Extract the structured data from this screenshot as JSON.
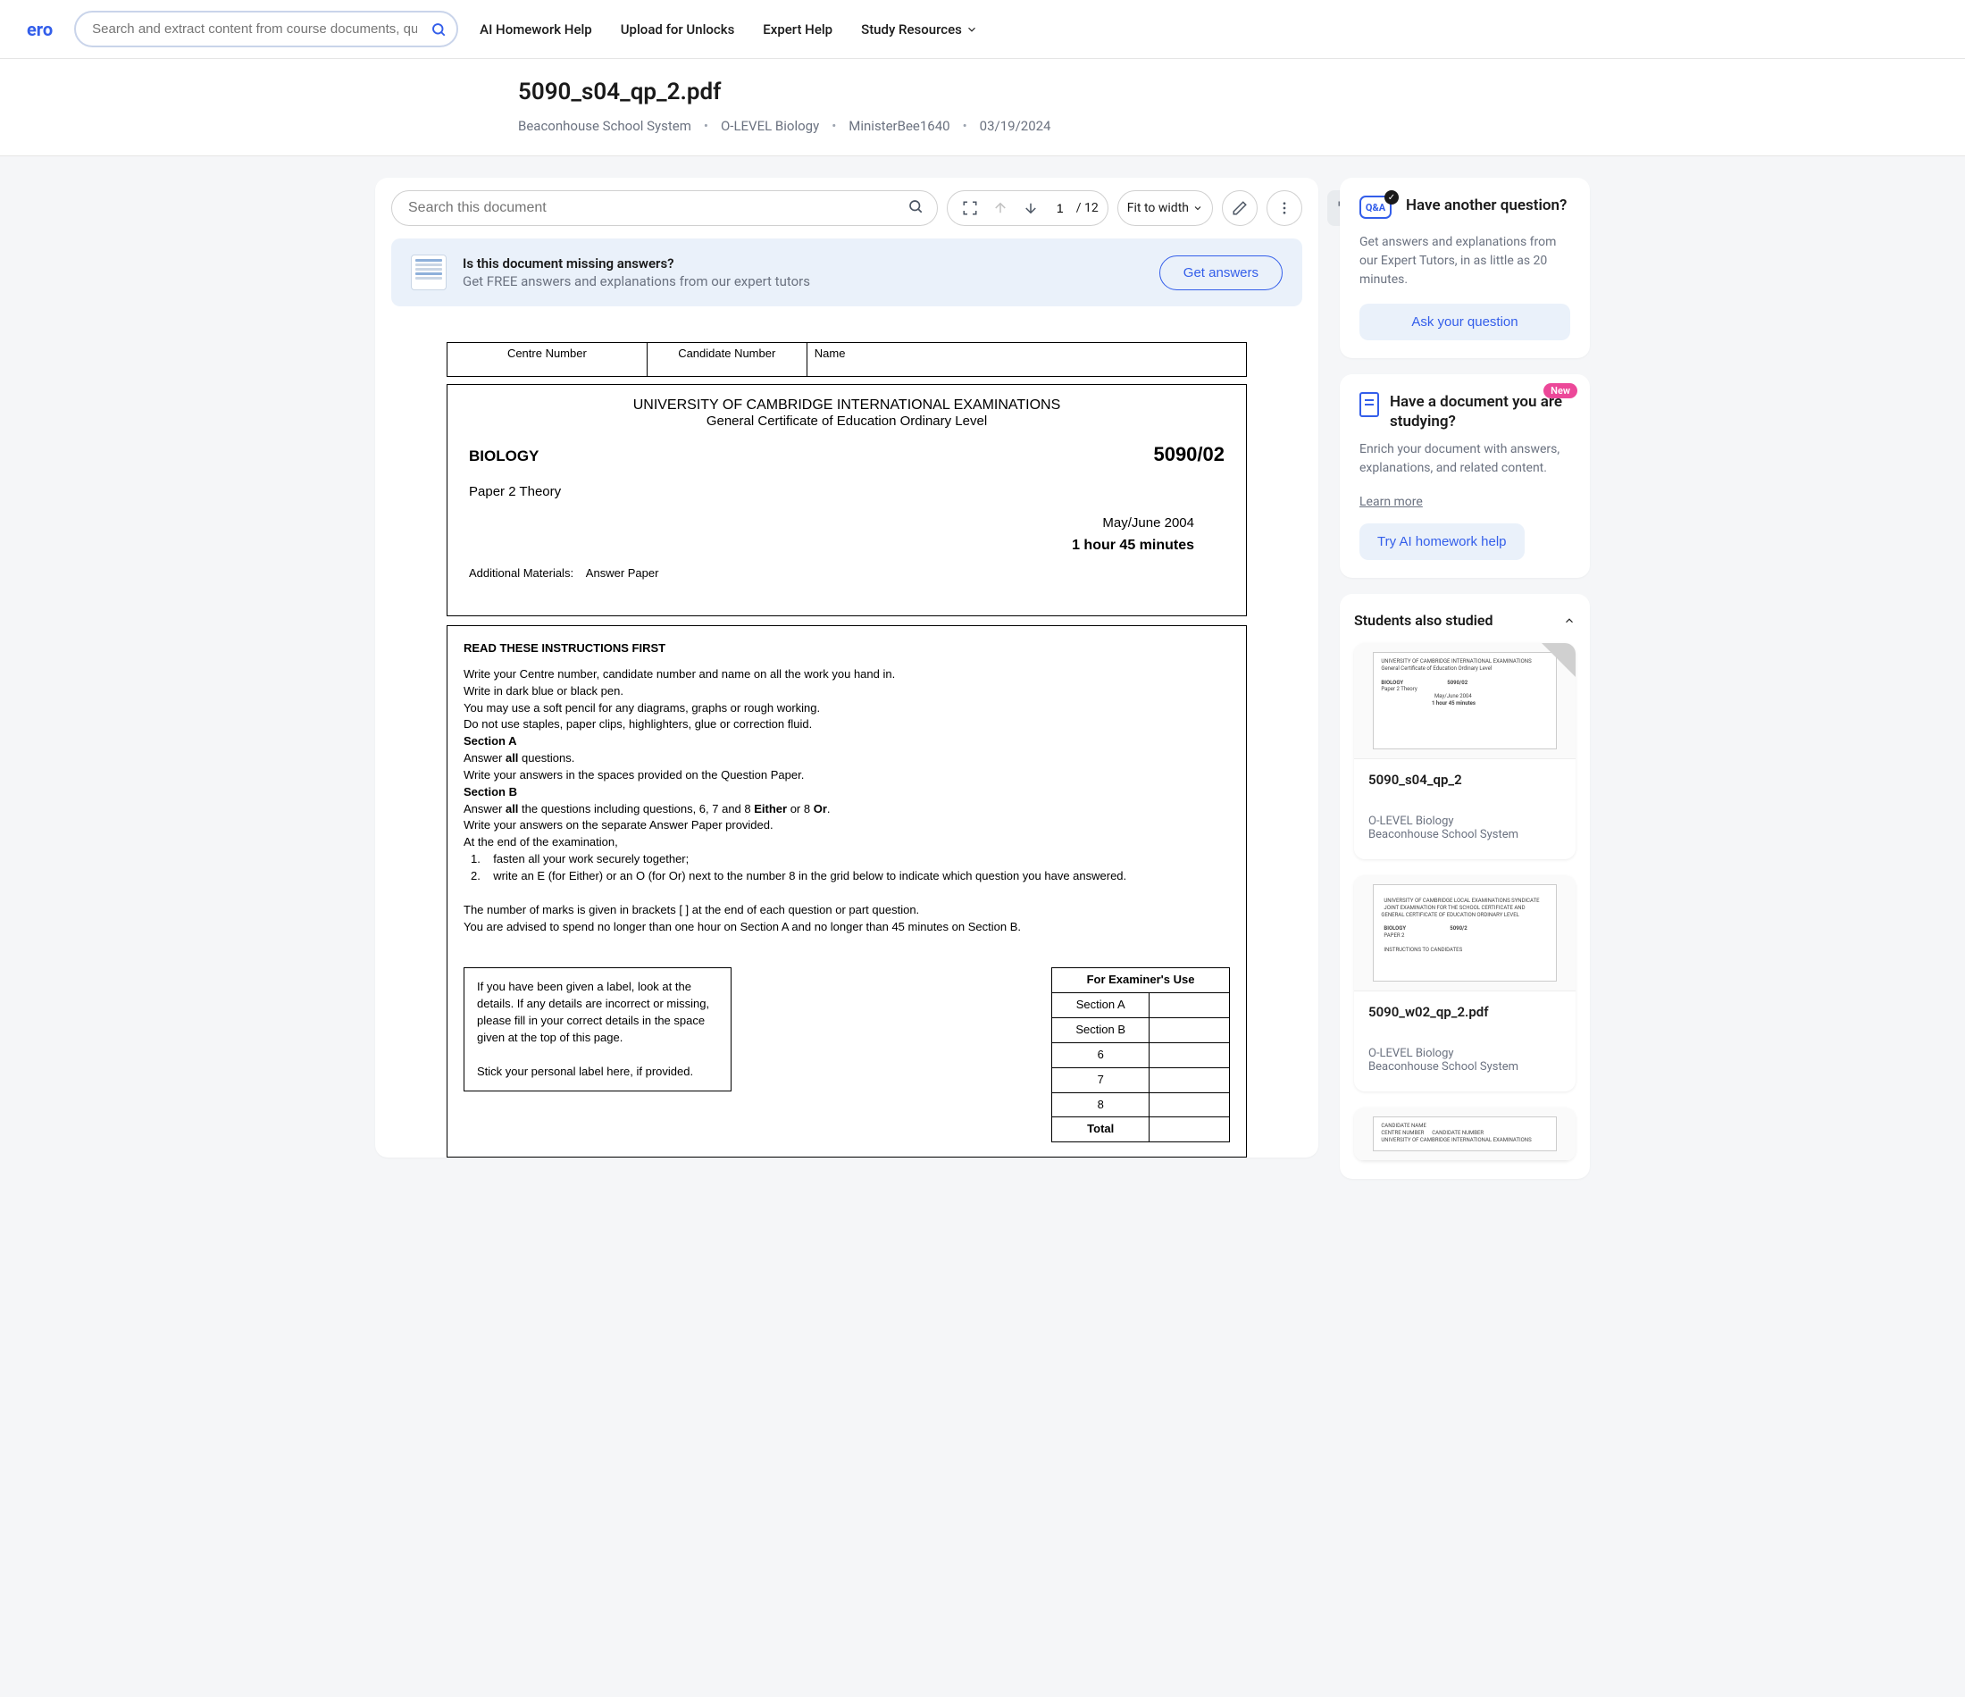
{
  "header": {
    "logo_fragment": "ero",
    "search_placeholder": "Search and extract content from course documents, questions, and textbooks with A",
    "nav": {
      "ai_help": "AI Homework Help",
      "upload": "Upload for Unlocks",
      "expert": "Expert Help",
      "resources": "Study Resources"
    }
  },
  "doc_header": {
    "title": "5090_s04_qp_2.pdf",
    "school": "Beaconhouse School System",
    "course": "O-LEVEL Biology",
    "uploader": "MinisterBee1640",
    "date": "03/19/2024"
  },
  "viewer": {
    "search_placeholder": "Search this document",
    "page_current": "1",
    "page_slash": "/ 12",
    "zoom": "Fit to width"
  },
  "promo": {
    "title": "Is this document missing answers?",
    "subtitle": "Get FREE answers and explanations from our expert tutors",
    "button": "Get answers"
  },
  "exam": {
    "hdr_centre": "Centre Number",
    "hdr_cand": "Candidate Number",
    "hdr_name": "Name",
    "university": "UNIVERSITY OF CAMBRIDGE INTERNATIONAL EXAMINATIONS",
    "certificate": "General Certificate of Education Ordinary Level",
    "subject": "BIOLOGY",
    "code": "5090/02",
    "paper": "Paper 2  Theory",
    "date": "May/June 2004",
    "duration": "1 hour 45 minutes",
    "materials_label": "Additional Materials:",
    "materials_value": "Answer Paper",
    "inst_title": "READ THESE INSTRUCTIONS FIRST",
    "inst_l1": "Write your Centre number, candidate number and name on all the work you hand in.",
    "inst_l2": "Write in dark blue or black pen.",
    "inst_l3": "You may use a soft pencil for any diagrams, graphs or rough working.",
    "inst_l4": "Do not use staples, paper clips, highlighters, glue or correction fluid.",
    "secA": "Section A",
    "secA_a1": "Answer ",
    "secA_a2": "all",
    "secA_a3": " questions.",
    "secA_l2": "Write your answers in the spaces provided on the Question Paper.",
    "secB": "Section B",
    "secB_a1": "Answer ",
    "secB_a2": "all",
    "secB_a3": " the questions including questions, 6, 7 and 8 ",
    "secB_a4": "Either",
    "secB_a5": " or 8 ",
    "secB_a6": "Or",
    "secB_a7": ".",
    "secB_l2": "Write your answers on the separate Answer Paper provided.",
    "secB_l3": "At the end of the examination,",
    "secB_l4n": "1.",
    "secB_l4": "fasten all your work securely together;",
    "secB_l5n": "2.",
    "secB_l5": "write an E (for Either) or an O (for Or) next to the number 8 in the grid below to indicate which question you have answered.",
    "marks_l1": "The number of marks is given in brackets [  ] at the end of each question or part question.",
    "marks_l2": "You are advised to spend no longer than one hour on Section A and no longer than 45 minutes on Section B.",
    "label_box_l1": "If you have been given a label, look at the details. If any details are incorrect or missing, please fill in your correct details in the space given at the top of this page.",
    "label_box_l2": "Stick your personal label here, if provided.",
    "marks_header": "For Examiner's Use",
    "marks_secA": "Section A",
    "marks_secB": "Section B",
    "marks_6": "6",
    "marks_7": "7",
    "marks_8": "8",
    "marks_total": "Total"
  },
  "side_qa": {
    "bubble": "Q&A",
    "title": "Have another question?",
    "desc": "Get answers and explanations from our Expert Tutors, in as little as 20 minutes.",
    "btn": "Ask your question"
  },
  "side_doc": {
    "badge": "New",
    "title": "Have a document you are studying?",
    "desc": "Enrich your document with answers, explanations, and related content.",
    "link": "Learn more",
    "btn": "Try AI homework help"
  },
  "also_studied": {
    "header": "Students also studied",
    "items": [
      {
        "name": "5090_s04_qp_2",
        "course": "O-LEVEL Biology",
        "school": "Beaconhouse School System"
      },
      {
        "name": "5090_w02_qp_2.pdf",
        "course": "O-LEVEL Biology",
        "school": "Beaconhouse School System"
      }
    ]
  }
}
